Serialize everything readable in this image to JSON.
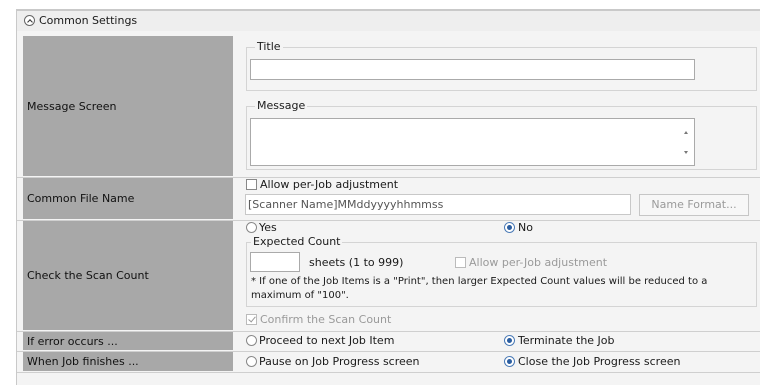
{
  "header": {
    "title": "Common Settings"
  },
  "message_screen": {
    "label": "Message Screen",
    "title_group": "Title",
    "title_value": "",
    "message_group": "Message",
    "message_value": ""
  },
  "common_file_name": {
    "label": "Common File Name",
    "allow_adjust": "Allow per-Job adjustment",
    "value": "[Scanner Name]MMddyyyyhhmmss",
    "name_format_button": "Name Format..."
  },
  "scan_count": {
    "label": "Check the Scan Count",
    "yes": "Yes",
    "no": "No",
    "expected_count_group": "Expected Count",
    "expected_value": "",
    "sheets_text": "sheets (1 to 999)",
    "allow_adjust": "Allow per-Job adjustment",
    "note": "* If one of the Job Items is a \"Print\", then larger Expected Count values will be reduced to a maximum of \"100\".",
    "confirm": "Confirm the Scan Count"
  },
  "error_occurs": {
    "label": "If error occurs ...",
    "option1": "Proceed to next Job Item",
    "option2": "Terminate the Job"
  },
  "job_finishes": {
    "label": "When Job finishes ...",
    "option1": "Pause on Job Progress screen",
    "option2": "Close the Job Progress screen"
  }
}
